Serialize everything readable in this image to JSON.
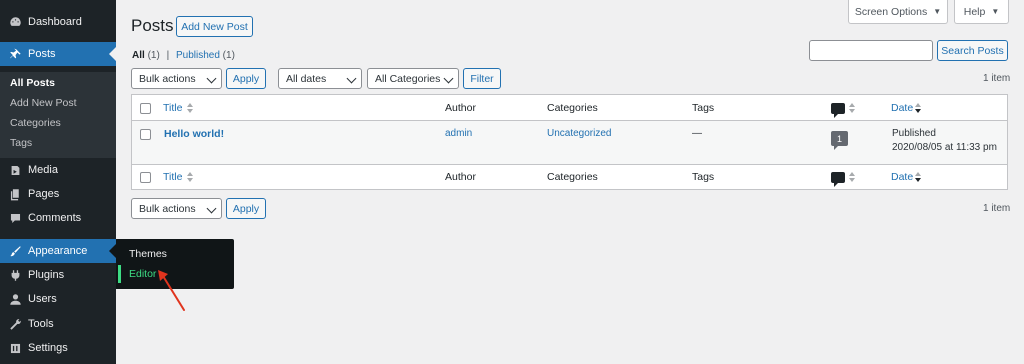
{
  "sidebar": {
    "items": [
      {
        "label": "Dashboard",
        "icon": "dashboard-icon"
      },
      {
        "label": "Posts",
        "icon": "pin-icon"
      },
      {
        "label": "Media",
        "icon": "media-icon"
      },
      {
        "label": "Pages",
        "icon": "pages-icon"
      },
      {
        "label": "Comments",
        "icon": "comment-icon"
      },
      {
        "label": "Appearance",
        "icon": "brush-icon"
      },
      {
        "label": "Plugins",
        "icon": "plugin-icon"
      },
      {
        "label": "Users",
        "icon": "user-icon"
      },
      {
        "label": "Tools",
        "icon": "wrench-icon"
      },
      {
        "label": "Settings",
        "icon": "settings-icon"
      }
    ],
    "posts_submenu": [
      "All Posts",
      "Add New Post",
      "Categories",
      "Tags"
    ],
    "appearance_flyout": [
      "Themes",
      "Editor"
    ]
  },
  "screen_options": {
    "label": "Screen Options",
    "caret": "▼"
  },
  "help": {
    "label": "Help",
    "caret": "▼"
  },
  "header": {
    "title": "Posts",
    "add_new": "Add New Post"
  },
  "views": {
    "all": "All",
    "all_count": "(1)",
    "sep": "|",
    "published": "Published",
    "published_count": "(1)"
  },
  "search": {
    "button": "Search Posts",
    "value": ""
  },
  "filters": {
    "bulk_actions": "Bulk actions",
    "apply": "Apply",
    "dates": "All dates",
    "categories": "All Categories",
    "filter": "Filter",
    "item_count": "1 item"
  },
  "table": {
    "columns": {
      "title": "Title",
      "author": "Author",
      "categories": "Categories",
      "tags": "Tags",
      "date": "Date"
    },
    "rows": [
      {
        "title": "Hello world!",
        "author": "admin",
        "categories": "Uncategorized",
        "tags": "—",
        "comments": "1",
        "date_status": "Published",
        "date_value": "2020/08/05 at 11:33 pm"
      }
    ]
  },
  "colors": {
    "accent": "#2271b1",
    "sidebar_bg": "#1d2327",
    "arrow": "#e0341e"
  }
}
